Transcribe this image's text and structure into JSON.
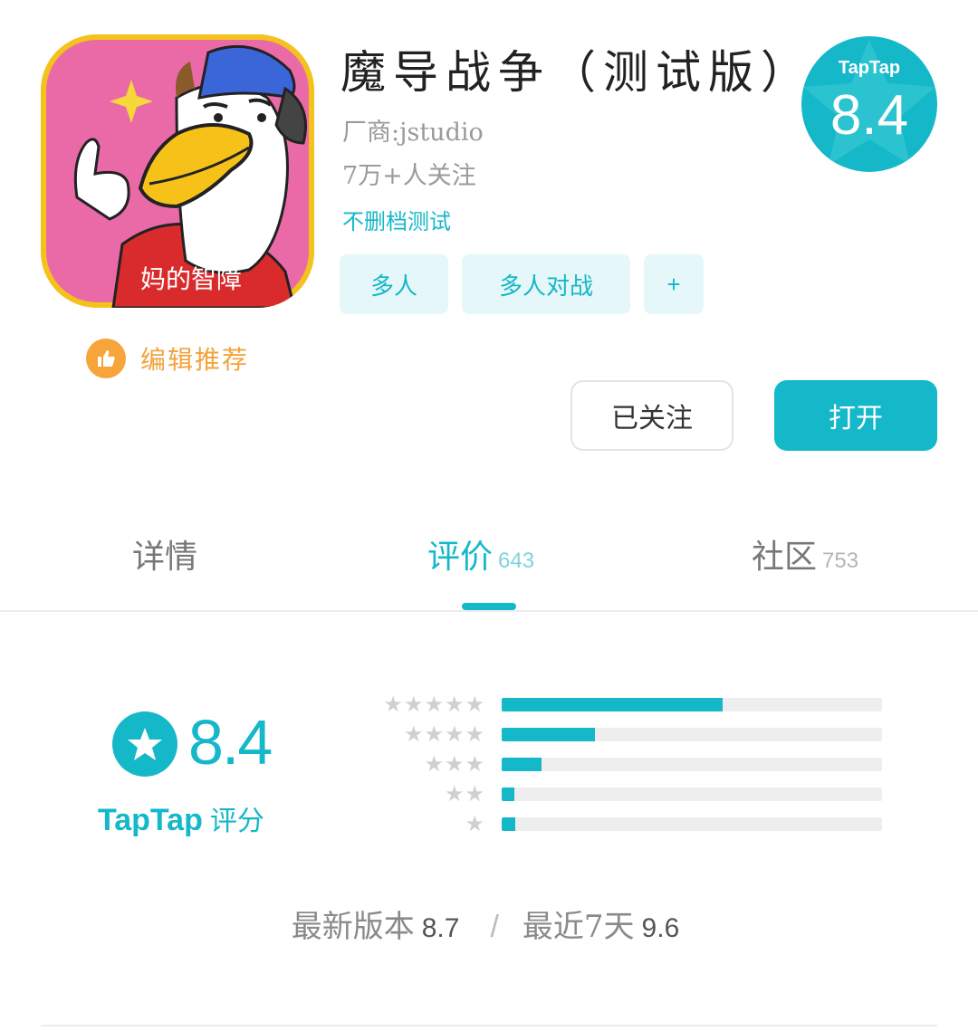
{
  "app": {
    "title": "魔导战争（测试版）",
    "vendor": "厂商:jstudio",
    "followers": "7万+人关注",
    "test_label": "不删档测试",
    "tags": [
      "多人",
      "多人对战",
      "+"
    ],
    "icon_caption": "妈的智障"
  },
  "badge": {
    "brand": "TapTap",
    "score": "8.4"
  },
  "editor_pick": "编辑推荐",
  "buttons": {
    "follow": "已关注",
    "open": "打开"
  },
  "tabs": [
    {
      "label": "详情",
      "count": ""
    },
    {
      "label": "评价",
      "count": "643"
    },
    {
      "label": "社区",
      "count": "753"
    }
  ],
  "rating": {
    "score": "8.4",
    "brand": "TapTap",
    "brand_suffix": "评分",
    "distribution": [
      {
        "stars": "★★★★★",
        "fraction": 0.58
      },
      {
        "stars": "★★★★",
        "fraction": 0.245
      },
      {
        "stars": "★★★",
        "fraction": 0.105
      },
      {
        "stars": "★★",
        "fraction": 0.033
      },
      {
        "stars": "★",
        "fraction": 0.036
      }
    ],
    "latest_label": "最新版本",
    "latest_value": "8.7",
    "separator": "/",
    "recent_label": "最近7天",
    "recent_value": "9.6"
  },
  "colors": {
    "accent": "#15b8c8",
    "editor_orange": "#f7a53a",
    "icon_pink": "#ea6aa8",
    "icon_border": "#f4c21c"
  }
}
